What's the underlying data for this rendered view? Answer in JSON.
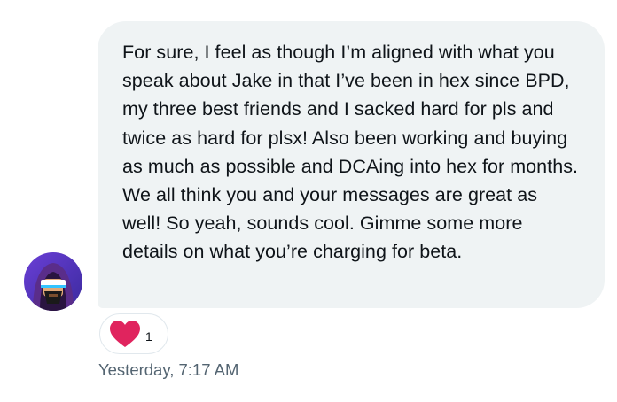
{
  "message": {
    "text": "For sure, I feel as though I’m aligned with what you speak about Jake in that I’ve been in hex since BPD, my three best friends and I sacked hard for pls and twice as hard for plsx! Also been working and buying as much as possible and DCAing into hex for months. We all think you and your messages are great as well! So yeah, sounds cool. Gimme some more details on what you’re charging for beta.",
    "timestamp": "Yesterday, 7:17 AM"
  },
  "reaction": {
    "icon": "heart-icon",
    "count": "1",
    "color": "#e0245e"
  },
  "colors": {
    "bubble": "#eff3f4",
    "text": "#0f1419",
    "muted": "#536471"
  }
}
